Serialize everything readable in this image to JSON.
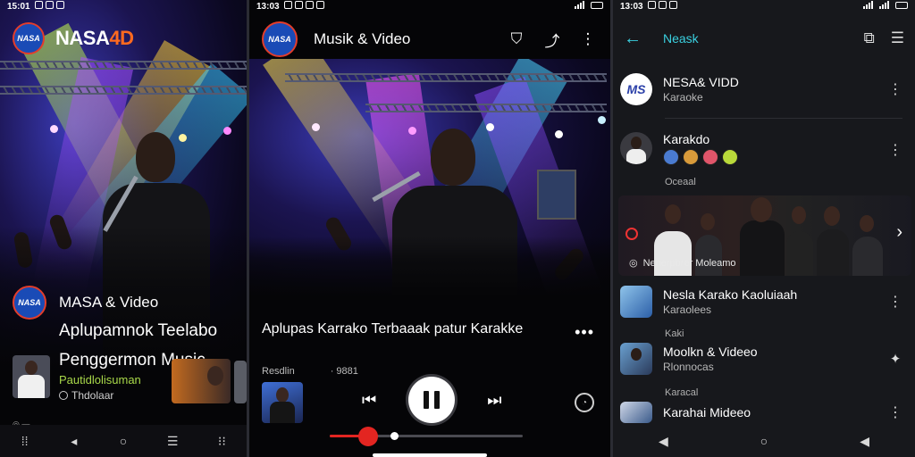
{
  "screen1": {
    "status_time": "15:01",
    "brand_prefix": "NASA",
    "brand_suffix": "4D",
    "channel_name": "MASA & Video",
    "title_line1": "Aplupamnok Teelabo",
    "title_line2": "Penggermon Music",
    "subtitle": "Pautidlolisuman",
    "meta": "Thdolaar",
    "logo_text": "NASA"
  },
  "screen2": {
    "status_time": "13:03",
    "header_title": "Musik & Video",
    "video_title": "Aplupas Karrako Terbaaak patur Karakke",
    "meta_left": "Resdlin",
    "meta_right": "· 9881",
    "progress": 0.2,
    "logo_text": "NASA"
  },
  "screen3": {
    "status_time": "13:03",
    "header_title": "Neask",
    "items": [
      {
        "title": "NESA& VIDD",
        "subtitle": "Karaoke"
      },
      {
        "title": "Karakdo",
        "subtitle": ""
      },
      {
        "title": "Nesla Karako Kaoluiaah",
        "subtitle": "Karaolees"
      },
      {
        "title": "Moolkn & Videeo",
        "subtitle": "Rlonnocas"
      },
      {
        "title": "Karahai Mideeo",
        "subtitle": ""
      }
    ],
    "section_comment": "Oceaal",
    "section_kaki": "Kaki",
    "section_karacal": "Karacal",
    "banner_caption": "Nenerpbrer Moleamo",
    "logo_text": "MS"
  },
  "colors": {
    "accent": "#3ad0e0",
    "brand_orange": "#ff6a1f",
    "progress_red": "#e32521",
    "subtitle_green": "#a9d94a"
  },
  "icons": {
    "screen1_nav": [
      "dots-icon",
      "back-icon",
      "home-icon",
      "menu-icon",
      "recent-icon"
    ],
    "screen2_header": [
      "bookmark-icon",
      "share-icon",
      "more-icon"
    ],
    "screen3_header": [
      "puzzle-icon",
      "library-icon"
    ]
  }
}
